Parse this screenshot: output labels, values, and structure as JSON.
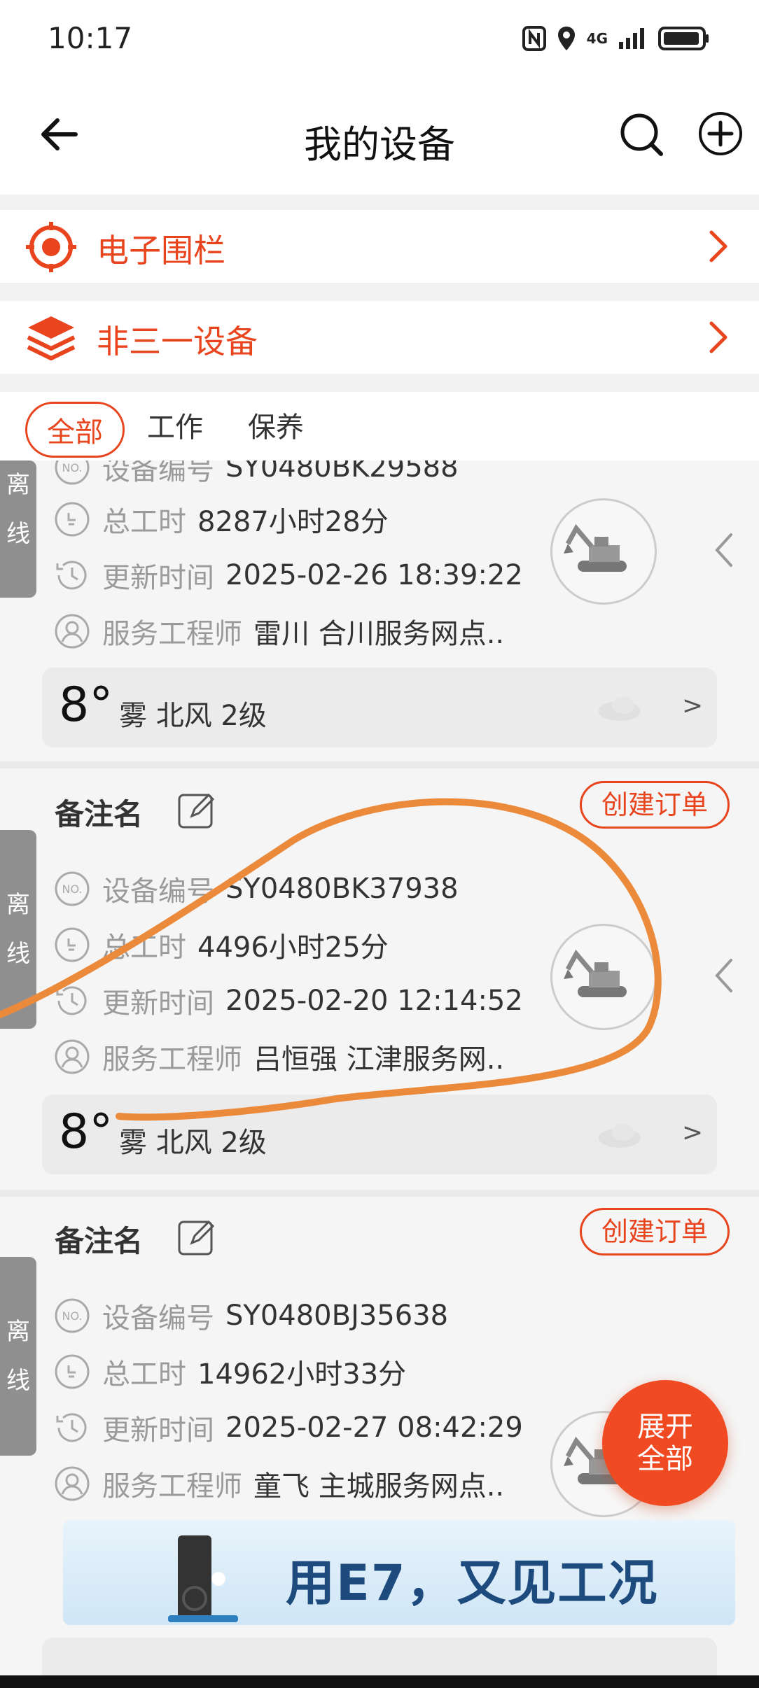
{
  "status_bar": {
    "time": "10:17",
    "network": "4G"
  },
  "header": {
    "title": "我的设备"
  },
  "entries": [
    {
      "label": "电子围栏",
      "icon": "target-icon"
    },
    {
      "label": "非三一设备",
      "icon": "layers-icon"
    }
  ],
  "filter_tabs": [
    {
      "label": "全部",
      "active": true
    },
    {
      "label": "工作",
      "active": false
    },
    {
      "label": "保养",
      "active": false
    }
  ],
  "row_labels": {
    "device_no": "设备编号",
    "total_hours": "总工时",
    "update_time": "更新时间",
    "engineer": "服务工程师"
  },
  "devices": [
    {
      "status": [
        "离",
        "线"
      ],
      "device_no": "SY0480BK29588",
      "total_hours": "8287小时28分",
      "update_time": "2025-02-26 18:39:22",
      "engineer": "雷川 合川服务网点..",
      "weather": {
        "temp": "8°",
        "desc": "雾  北风  2级",
        "more": ">"
      }
    },
    {
      "status": [
        "离",
        "线"
      ],
      "remark_label": "备注名",
      "order_button": "创建订单",
      "device_no": "SY0480BK37938",
      "total_hours": "4496小时25分",
      "update_time": "2025-02-20 12:14:52",
      "engineer": "吕恒强 江津服务网..",
      "weather": {
        "temp": "8°",
        "desc": "雾  北风  2级",
        "more": ">"
      }
    },
    {
      "status": [
        "离",
        "线"
      ],
      "remark_label": "备注名",
      "order_button": "创建订单",
      "device_no": "SY0480BJ35638",
      "total_hours": "14962小时33分",
      "update_time": "2025-02-27 08:42:29",
      "engineer": "童飞 主城服务网点.."
    }
  ],
  "fab": {
    "line1": "展开",
    "line2": "全部"
  },
  "banner": {
    "text": "用E7，又见工况"
  },
  "colors": {
    "accent": "#e8451e",
    "annotation": "#ec8a3c",
    "offline_badge": "#8f8f8f"
  }
}
